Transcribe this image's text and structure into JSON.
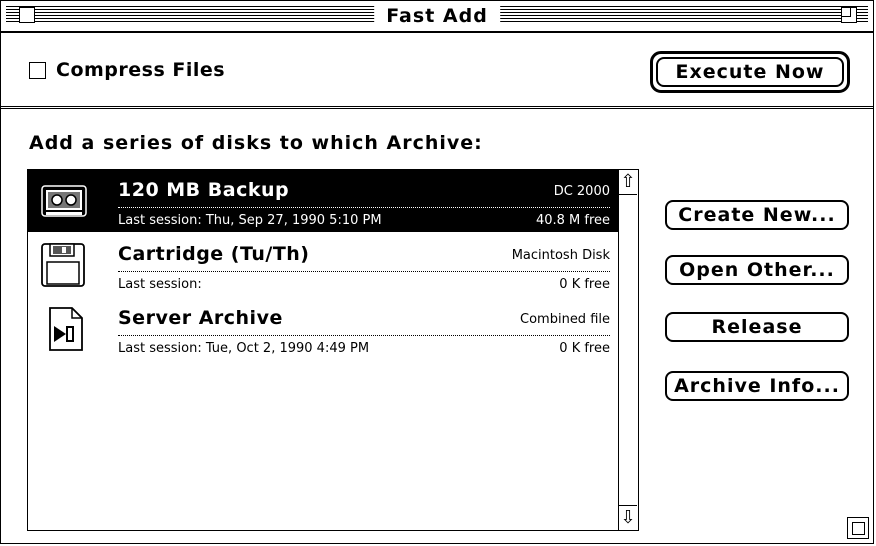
{
  "window": {
    "title": "Fast Add"
  },
  "compress": {
    "label": "Compress Files",
    "checked": false
  },
  "buttons": {
    "execute": "Execute Now",
    "create_new": "Create New...",
    "open_other": "Open Other...",
    "release": "Release",
    "archive_info": "Archive Info..."
  },
  "instruction": "Add a series of disks to which Archive:",
  "archives": [
    {
      "name": "120 MB Backup",
      "type": "DC 2000",
      "session": "Last session: Thu, Sep 27, 1990  5:10 PM",
      "free": "40.8 M  free",
      "icon": "tape-drive-icon",
      "selected": true
    },
    {
      "name": "Cartridge (Tu/Th)",
      "type": "Macintosh Disk",
      "session": "Last session:",
      "free": "0 K  free",
      "icon": "floppy-disk-icon",
      "selected": false
    },
    {
      "name": "Server Archive",
      "type": "Combined file",
      "session": "Last session: Tue, Oct 2, 1990  4:49 PM",
      "free": "0 K  free",
      "icon": "archive-file-icon",
      "selected": false
    }
  ]
}
